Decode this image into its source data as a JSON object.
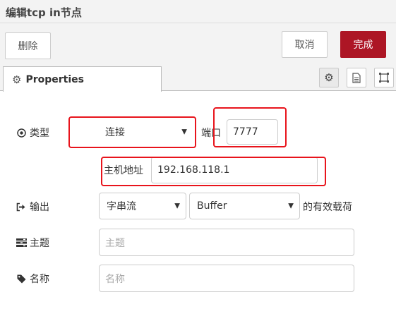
{
  "title": "编辑tcp in节点",
  "toolbar": {
    "delete_label": "删除",
    "cancel_label": "取消",
    "done_label": "完成"
  },
  "tab": {
    "label": "Properties"
  },
  "icons": {
    "tab": "gear-icon",
    "settings": "gear-icon",
    "description": "document-icon",
    "appearance": "frame-icon"
  },
  "form": {
    "type": {
      "label": "类型",
      "value": "连接"
    },
    "port": {
      "label": "端口",
      "value": "7777"
    },
    "host": {
      "label": "主机地址",
      "value": "192.168.118.1"
    },
    "output": {
      "label": "输出",
      "value": "字串流",
      "format": "Buffer",
      "suffix": "的有效载荷"
    },
    "topic": {
      "label": "主题",
      "placeholder": "主题"
    },
    "name": {
      "label": "名称",
      "placeholder": "名称"
    }
  },
  "colors": {
    "primary": "#ad1625",
    "highlight": "#e8141c",
    "toolbar": "#f3f3f3"
  }
}
